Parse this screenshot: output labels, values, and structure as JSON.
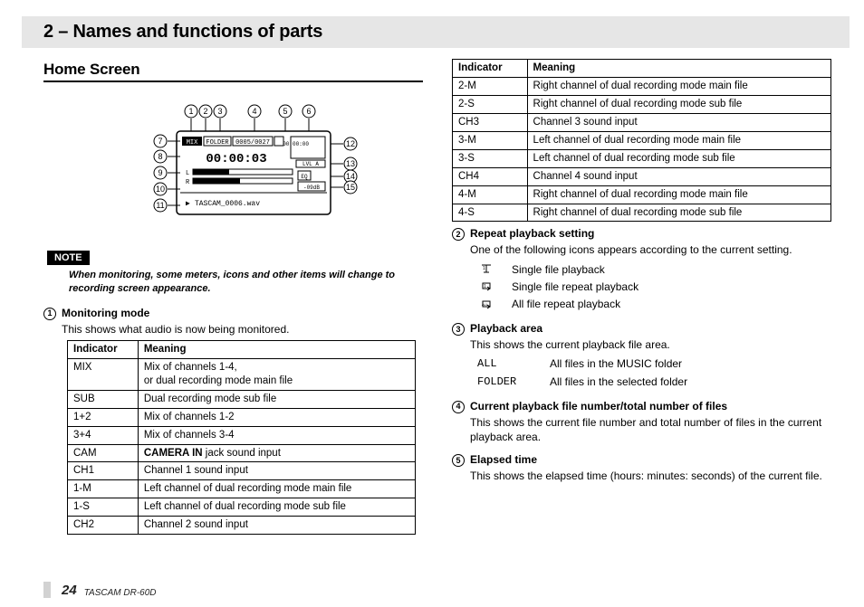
{
  "chapter_title": "2 – Names and functions of parts",
  "section_title": "Home Screen",
  "note_label": "NOTE",
  "note_text": "When monitoring, some meters, icons and other items will change to recording screen appearance.",
  "diagram": {
    "callout_numbers": [
      1,
      2,
      3,
      4,
      5,
      6,
      7,
      8,
      9,
      10,
      11,
      12,
      13,
      14,
      15
    ],
    "lcd": {
      "top_row": [
        "MIX",
        "FOLDER",
        "0005/0027"
      ],
      "time": "00:00:03",
      "time_sub": "00:00:00",
      "channels": [
        "L",
        "R"
      ],
      "lvl_label": "LVL A",
      "eq_label": "EQ",
      "db_label": "-09dB",
      "filename": "TASCAM_0006.wav",
      "arrow_glyph": "▶"
    }
  },
  "items_left": [
    {
      "num": 1,
      "title": "Monitoring mode",
      "desc": "This shows what audio is now being monitored.",
      "table": {
        "headers": [
          "Indicator",
          "Meaning"
        ],
        "rows": [
          [
            "MIX",
            "Mix of channels 1-4,\nor dual recording mode main file"
          ],
          [
            "SUB",
            "Dual recording mode sub file"
          ],
          [
            "1+2",
            "Mix of channels 1-2"
          ],
          [
            "3+4",
            "Mix of channels 3-4"
          ],
          [
            "CAM",
            "<b>CAMERA IN</b> jack sound input"
          ],
          [
            "CH1",
            "Channel 1 sound input"
          ],
          [
            "1-M",
            "Left channel of dual recording mode main file"
          ],
          [
            "1-S",
            "Left channel of dual recording mode sub file"
          ],
          [
            "CH2",
            "Channel 2 sound input"
          ]
        ]
      }
    }
  ],
  "table_right": {
    "headers": [
      "Indicator",
      "Meaning"
    ],
    "rows": [
      [
        "2-M",
        "Right channel of dual recording mode main file"
      ],
      [
        "2-S",
        "Right channel of dual recording mode sub file"
      ],
      [
        "CH3",
        "Channel 3 sound input"
      ],
      [
        "3-M",
        "Left channel of dual recording mode main file"
      ],
      [
        "3-S",
        "Left channel of dual recording mode sub file"
      ],
      [
        "CH4",
        "Channel 4 sound input"
      ],
      [
        "4-M",
        "Right channel of dual recording mode main file"
      ],
      [
        "4-S",
        "Right channel of dual recording mode sub file"
      ]
    ]
  },
  "items_right": [
    {
      "num": 2,
      "title": "Repeat playback setting",
      "desc": "One of the following icons appears according to the current setting.",
      "options": [
        {
          "icon": "single-play-icon",
          "label": "Single file playback"
        },
        {
          "icon": "single-repeat-icon",
          "label": "Single file repeat playback"
        },
        {
          "icon": "all-repeat-icon",
          "label": "All file repeat playback"
        }
      ]
    },
    {
      "num": 3,
      "title": "Playback area",
      "desc": "This shows the current playback file area.",
      "map": [
        {
          "key": "ALL",
          "label": "All files in the MUSIC folder"
        },
        {
          "key": "FOLDER",
          "label": "All files in the selected folder"
        }
      ]
    },
    {
      "num": 4,
      "title": "Current playback file number/total number of files",
      "desc": "This shows the current file number and total number of files in the current playback area."
    },
    {
      "num": 5,
      "title": "Elapsed time",
      "desc": "This shows the elapsed time (hours: minutes: seconds) of the current file."
    }
  ],
  "footer": {
    "page": "24",
    "model": "TASCAM  DR-60D"
  }
}
